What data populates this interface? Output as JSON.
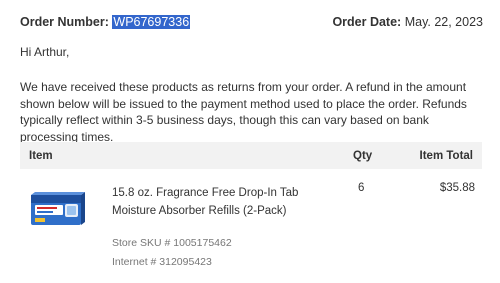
{
  "order": {
    "number_label": "Order Number:",
    "number_value": "WP67697336",
    "date_label": "Order Date:",
    "date_value": "May. 22, 2023"
  },
  "greeting": "Hi Arthur,",
  "message": "We have received these products as returns from your order. A refund in the amount shown below will be issued to the payment method used to place the order. Refunds typically reflect within 3-5 business days, though this can vary based on bank processing times.",
  "table": {
    "headers": {
      "item": "Item",
      "qty": "Qty",
      "total": "Item Total"
    },
    "rows": [
      {
        "name": "15.8 oz. Fragrance Free Drop-In Tab Moisture Absorber Refills (2-Pack)",
        "qty": "6",
        "total": "$35.88",
        "store_sku": "Store SKU # 1005175462",
        "internet": "Internet # 312095423",
        "image_icon": "product-package-image"
      }
    ]
  },
  "colors": {
    "highlight": "#3366cc",
    "header_bg": "#f2f2f2",
    "muted_text": "#777777"
  }
}
